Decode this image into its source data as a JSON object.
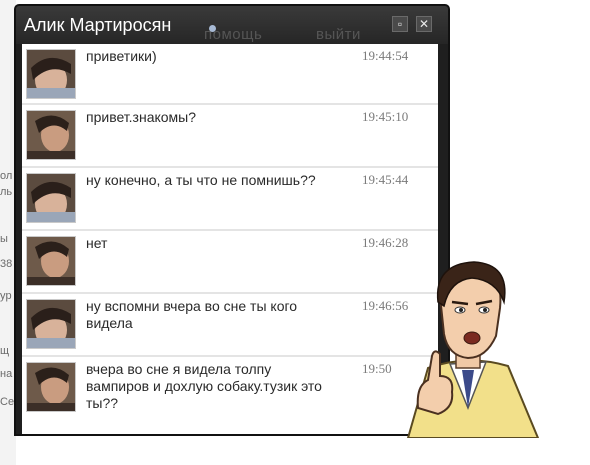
{
  "window": {
    "contact_name": "Алик Мартиросян",
    "background_tabs": [
      "помощь",
      "выйти"
    ],
    "minimize_glyph": "▫",
    "close_glyph": "✕"
  },
  "messages": [
    {
      "text": "приветики)",
      "time": "19:44:54"
    },
    {
      "text": "привет.знакомы?",
      "time": "19:45:10"
    },
    {
      "text": "ну конечно, а ты что не помнишь??",
      "time": "19:45:44"
    },
    {
      "text": "нет",
      "time": "19:46:28"
    },
    {
      "text": "ну вспомни вчера во сне ты кого видела",
      "time": "19:46:56"
    },
    {
      "text": "вчера во сне я видела толпу вампиров и дохлую собаку.тузик это ты??",
      "time": "19:50"
    }
  ],
  "background_fragments": [
    "ол",
    "ль",
    "ы",
    "38",
    "yp",
    "щ",
    "на",
    "Се"
  ]
}
